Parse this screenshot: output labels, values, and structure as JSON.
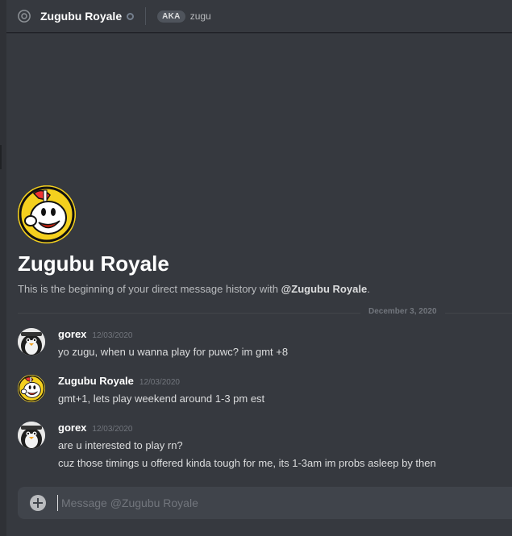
{
  "header": {
    "title": "Zugubu Royale",
    "aka_label": "AKA",
    "aka_name": "zugu"
  },
  "intro": {
    "title": "Zugubu Royale",
    "subtitle_prefix": "This is the beginning of your direct message history with ",
    "subtitle_handle": "@Zugubu Royale",
    "subtitle_suffix": "."
  },
  "date_divider": "December 3, 2020",
  "messages": [
    {
      "author": "gorex",
      "timestamp": "12/03/2020",
      "avatar": "penguin-avatar",
      "lines": [
        "yo zugu, when u wanna play for puwc? im gmt +8"
      ]
    },
    {
      "author": "Zugubu Royale",
      "timestamp": "12/03/2020",
      "avatar": "cuphead-avatar",
      "lines": [
        "gmt+1, lets play weekend around 1-3 pm est"
      ]
    },
    {
      "author": "gorex",
      "timestamp": "12/03/2020",
      "avatar": "penguin-avatar",
      "lines": [
        "are u interested to play rn?",
        "cuz those timings u offered kinda tough for me, its 1-3am im probs asleep by then"
      ]
    }
  ],
  "composer": {
    "placeholder": "Message @Zugubu Royale",
    "value": ""
  },
  "colors": {
    "background": "#36393f",
    "composer": "#40444b",
    "muted": "#72767d",
    "text": "#dcddde"
  }
}
